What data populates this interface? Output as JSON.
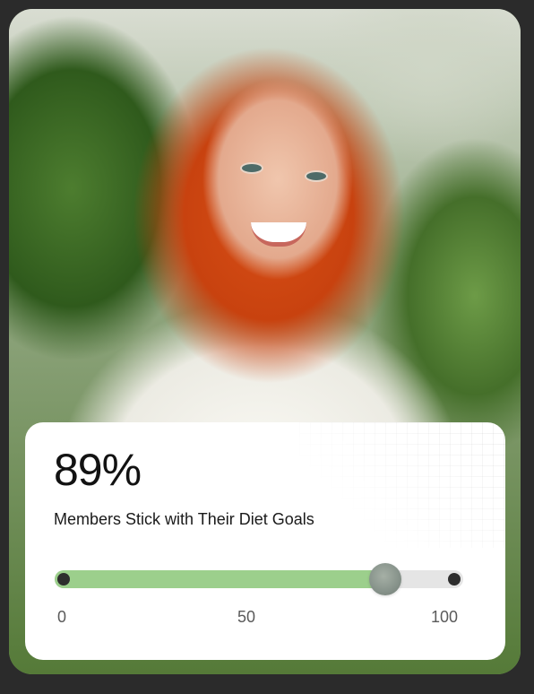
{
  "stat": {
    "value": "89%",
    "caption": "Members Stick with Their Diet Goals"
  },
  "slider": {
    "level_percent": 81,
    "min_label": "0",
    "mid_label": "50",
    "max_label": "100"
  },
  "colors": {
    "fill": "#9ccf8c",
    "track": "#e5e5e5",
    "thumb": "#86928a",
    "end_dot": "#2e2e2e"
  }
}
